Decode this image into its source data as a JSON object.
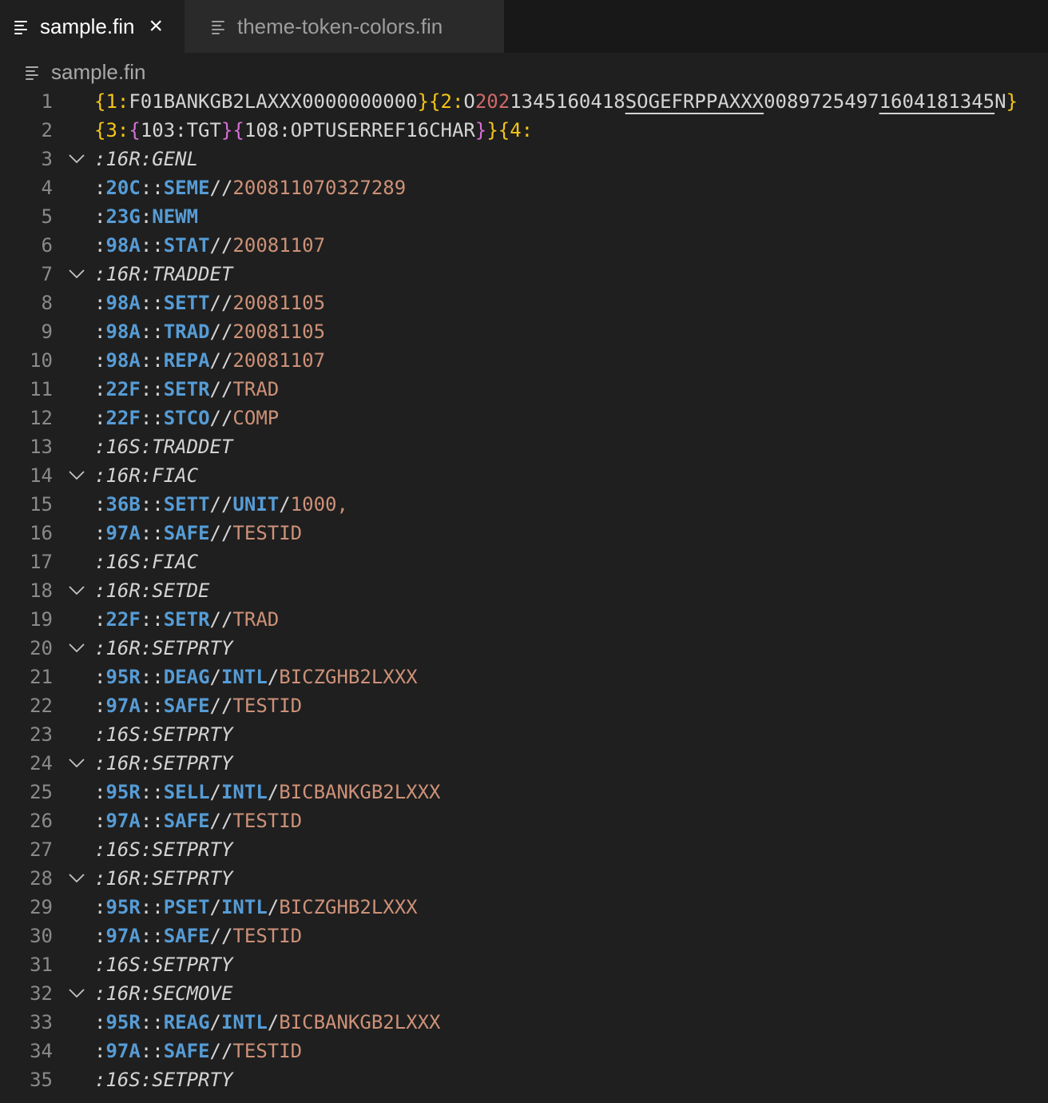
{
  "tabs": [
    {
      "label": "sample.fin",
      "active": true
    },
    {
      "label": "theme-token-colors.fin",
      "active": false
    }
  ],
  "breadcrumb": "sample.fin",
  "colors": {
    "background": "#1f1f1f",
    "tag": "#569cd6",
    "value": "#ce9178",
    "brace_outer": "#f5c518",
    "brace_inner": "#d670d6"
  },
  "lines": [
    {
      "n": "1",
      "fold": false,
      "tokens": [
        {
          "t": "{1:",
          "c": "t-brace-y"
        },
        {
          "t": "F01BANKGB2LAXXX0000000000",
          "c": "t-hdr"
        },
        {
          "t": "}",
          "c": "t-brace-y"
        },
        {
          "t": "{2:",
          "c": "t-brace-y"
        },
        {
          "t": "O",
          "c": "t-hdr"
        },
        {
          "t": "202",
          "c": "t-red"
        },
        {
          "t": "1345160418",
          "c": "t-hdr"
        },
        {
          "t": "SOGEFRPPAXXX",
          "c": "t-hdr t-uline"
        },
        {
          "t": "0089725497",
          "c": "t-hdr"
        },
        {
          "t": "1604181345",
          "c": "t-hdr t-uline"
        },
        {
          "t": "N",
          "c": "t-hdr"
        },
        {
          "t": "}",
          "c": "t-brace-y"
        }
      ]
    },
    {
      "n": "2",
      "fold": false,
      "tokens": [
        {
          "t": "{3:",
          "c": "t-brace-y"
        },
        {
          "t": "{",
          "c": "t-brace-p"
        },
        {
          "t": "103:TGT",
          "c": "t-hdr"
        },
        {
          "t": "}",
          "c": "t-brace-p"
        },
        {
          "t": "{",
          "c": "t-brace-p"
        },
        {
          "t": "108:OPTUSERREF16CHAR",
          "c": "t-hdr"
        },
        {
          "t": "}",
          "c": "t-brace-p"
        },
        {
          "t": "}",
          "c": "t-brace-y"
        },
        {
          "t": "{4:",
          "c": "t-brace-y"
        }
      ]
    },
    {
      "n": "3",
      "fold": true,
      "tokens": [
        {
          "t": ":16R:GENL",
          "c": "t-seq"
        }
      ]
    },
    {
      "n": "4",
      "fold": false,
      "tokens": [
        {
          "t": ":",
          "c": "t-punct"
        },
        {
          "t": "20C",
          "c": "t-tag"
        },
        {
          "t": "::",
          "c": "t-punct"
        },
        {
          "t": "SEME",
          "c": "t-qual"
        },
        {
          "t": "//",
          "c": "t-punct"
        },
        {
          "t": "200811070327289",
          "c": "t-val"
        }
      ]
    },
    {
      "n": "5",
      "fold": false,
      "tokens": [
        {
          "t": ":",
          "c": "t-punct"
        },
        {
          "t": "23G",
          "c": "t-tag"
        },
        {
          "t": ":",
          "c": "t-punct"
        },
        {
          "t": "NEWM",
          "c": "t-qual"
        }
      ]
    },
    {
      "n": "6",
      "fold": false,
      "tokens": [
        {
          "t": ":",
          "c": "t-punct"
        },
        {
          "t": "98A",
          "c": "t-tag"
        },
        {
          "t": "::",
          "c": "t-punct"
        },
        {
          "t": "STAT",
          "c": "t-qual"
        },
        {
          "t": "//",
          "c": "t-punct"
        },
        {
          "t": "20081107",
          "c": "t-val"
        }
      ]
    },
    {
      "n": "7",
      "fold": true,
      "tokens": [
        {
          "t": ":16R:TRADDET",
          "c": "t-seq"
        }
      ]
    },
    {
      "n": "8",
      "fold": false,
      "tokens": [
        {
          "t": ":",
          "c": "t-punct"
        },
        {
          "t": "98A",
          "c": "t-tag"
        },
        {
          "t": "::",
          "c": "t-punct"
        },
        {
          "t": "SETT",
          "c": "t-qual"
        },
        {
          "t": "//",
          "c": "t-punct"
        },
        {
          "t": "20081105",
          "c": "t-val"
        }
      ]
    },
    {
      "n": "9",
      "fold": false,
      "tokens": [
        {
          "t": ":",
          "c": "t-punct"
        },
        {
          "t": "98A",
          "c": "t-tag"
        },
        {
          "t": "::",
          "c": "t-punct"
        },
        {
          "t": "TRAD",
          "c": "t-qual"
        },
        {
          "t": "//",
          "c": "t-punct"
        },
        {
          "t": "20081105",
          "c": "t-val"
        }
      ]
    },
    {
      "n": "10",
      "fold": false,
      "tokens": [
        {
          "t": ":",
          "c": "t-punct"
        },
        {
          "t": "98A",
          "c": "t-tag"
        },
        {
          "t": "::",
          "c": "t-punct"
        },
        {
          "t": "REPA",
          "c": "t-qual"
        },
        {
          "t": "//",
          "c": "t-punct"
        },
        {
          "t": "20081107",
          "c": "t-val"
        }
      ]
    },
    {
      "n": "11",
      "fold": false,
      "tokens": [
        {
          "t": ":",
          "c": "t-punct"
        },
        {
          "t": "22F",
          "c": "t-tag"
        },
        {
          "t": "::",
          "c": "t-punct"
        },
        {
          "t": "SETR",
          "c": "t-qual"
        },
        {
          "t": "//",
          "c": "t-punct"
        },
        {
          "t": "TRAD",
          "c": "t-val"
        }
      ]
    },
    {
      "n": "12",
      "fold": false,
      "tokens": [
        {
          "t": ":",
          "c": "t-punct"
        },
        {
          "t": "22F",
          "c": "t-tag"
        },
        {
          "t": "::",
          "c": "t-punct"
        },
        {
          "t": "STCO",
          "c": "t-qual"
        },
        {
          "t": "//",
          "c": "t-punct"
        },
        {
          "t": "COMP",
          "c": "t-val"
        }
      ]
    },
    {
      "n": "13",
      "fold": false,
      "tokens": [
        {
          "t": ":16S:TRADDET",
          "c": "t-seq"
        }
      ]
    },
    {
      "n": "14",
      "fold": true,
      "tokens": [
        {
          "t": ":16R:FIAC",
          "c": "t-seq"
        }
      ]
    },
    {
      "n": "15",
      "fold": false,
      "tokens": [
        {
          "t": ":",
          "c": "t-punct"
        },
        {
          "t": "36B",
          "c": "t-tag"
        },
        {
          "t": "::",
          "c": "t-punct"
        },
        {
          "t": "SETT",
          "c": "t-qual"
        },
        {
          "t": "//",
          "c": "t-punct"
        },
        {
          "t": "UNIT",
          "c": "t-qual"
        },
        {
          "t": "/",
          "c": "t-punct"
        },
        {
          "t": "1000,",
          "c": "t-val"
        }
      ]
    },
    {
      "n": "16",
      "fold": false,
      "tokens": [
        {
          "t": ":",
          "c": "t-punct"
        },
        {
          "t": "97A",
          "c": "t-tag"
        },
        {
          "t": "::",
          "c": "t-punct"
        },
        {
          "t": "SAFE",
          "c": "t-qual"
        },
        {
          "t": "//",
          "c": "t-punct"
        },
        {
          "t": "TESTID",
          "c": "t-val"
        }
      ]
    },
    {
      "n": "17",
      "fold": false,
      "tokens": [
        {
          "t": ":16S:FIAC",
          "c": "t-seq"
        }
      ]
    },
    {
      "n": "18",
      "fold": true,
      "tokens": [
        {
          "t": ":16R:SETDE",
          "c": "t-seq"
        }
      ]
    },
    {
      "n": "19",
      "fold": false,
      "tokens": [
        {
          "t": ":",
          "c": "t-punct"
        },
        {
          "t": "22F",
          "c": "t-tag"
        },
        {
          "t": "::",
          "c": "t-punct"
        },
        {
          "t": "SETR",
          "c": "t-qual"
        },
        {
          "t": "//",
          "c": "t-punct"
        },
        {
          "t": "TRAD",
          "c": "t-val"
        }
      ]
    },
    {
      "n": "20",
      "fold": true,
      "tokens": [
        {
          "t": ":16R:SETPRTY",
          "c": "t-seq"
        }
      ]
    },
    {
      "n": "21",
      "fold": false,
      "tokens": [
        {
          "t": ":",
          "c": "t-punct"
        },
        {
          "t": "95R",
          "c": "t-tag"
        },
        {
          "t": "::",
          "c": "t-punct"
        },
        {
          "t": "DEAG",
          "c": "t-qual"
        },
        {
          "t": "/",
          "c": "t-punct"
        },
        {
          "t": "INTL",
          "c": "t-qual"
        },
        {
          "t": "/",
          "c": "t-punct"
        },
        {
          "t": "BICZGHB2LXXX",
          "c": "t-val"
        }
      ]
    },
    {
      "n": "22",
      "fold": false,
      "tokens": [
        {
          "t": ":",
          "c": "t-punct"
        },
        {
          "t": "97A",
          "c": "t-tag"
        },
        {
          "t": "::",
          "c": "t-punct"
        },
        {
          "t": "SAFE",
          "c": "t-qual"
        },
        {
          "t": "//",
          "c": "t-punct"
        },
        {
          "t": "TESTID",
          "c": "t-val"
        }
      ]
    },
    {
      "n": "23",
      "fold": false,
      "tokens": [
        {
          "t": ":16S:SETPRTY",
          "c": "t-seq"
        }
      ]
    },
    {
      "n": "24",
      "fold": true,
      "tokens": [
        {
          "t": ":16R:SETPRTY",
          "c": "t-seq"
        }
      ]
    },
    {
      "n": "25",
      "fold": false,
      "tokens": [
        {
          "t": ":",
          "c": "t-punct"
        },
        {
          "t": "95R",
          "c": "t-tag"
        },
        {
          "t": "::",
          "c": "t-punct"
        },
        {
          "t": "SELL",
          "c": "t-qual"
        },
        {
          "t": "/",
          "c": "t-punct"
        },
        {
          "t": "INTL",
          "c": "t-qual"
        },
        {
          "t": "/",
          "c": "t-punct"
        },
        {
          "t": "BICBANKGB2LXXX",
          "c": "t-val"
        }
      ]
    },
    {
      "n": "26",
      "fold": false,
      "tokens": [
        {
          "t": ":",
          "c": "t-punct"
        },
        {
          "t": "97A",
          "c": "t-tag"
        },
        {
          "t": "::",
          "c": "t-punct"
        },
        {
          "t": "SAFE",
          "c": "t-qual"
        },
        {
          "t": "//",
          "c": "t-punct"
        },
        {
          "t": "TESTID",
          "c": "t-val"
        }
      ]
    },
    {
      "n": "27",
      "fold": false,
      "tokens": [
        {
          "t": ":16S:SETPRTY",
          "c": "t-seq"
        }
      ]
    },
    {
      "n": "28",
      "fold": true,
      "tokens": [
        {
          "t": ":16R:SETPRTY",
          "c": "t-seq"
        }
      ]
    },
    {
      "n": "29",
      "fold": false,
      "tokens": [
        {
          "t": ":",
          "c": "t-punct"
        },
        {
          "t": "95R",
          "c": "t-tag"
        },
        {
          "t": "::",
          "c": "t-punct"
        },
        {
          "t": "PSET",
          "c": "t-qual"
        },
        {
          "t": "/",
          "c": "t-punct"
        },
        {
          "t": "INTL",
          "c": "t-qual"
        },
        {
          "t": "/",
          "c": "t-punct"
        },
        {
          "t": "BICZGHB2LXXX",
          "c": "t-val"
        }
      ]
    },
    {
      "n": "30",
      "fold": false,
      "tokens": [
        {
          "t": ":",
          "c": "t-punct"
        },
        {
          "t": "97A",
          "c": "t-tag"
        },
        {
          "t": "::",
          "c": "t-punct"
        },
        {
          "t": "SAFE",
          "c": "t-qual"
        },
        {
          "t": "//",
          "c": "t-punct"
        },
        {
          "t": "TESTID",
          "c": "t-val"
        }
      ]
    },
    {
      "n": "31",
      "fold": false,
      "tokens": [
        {
          "t": ":16S:SETPRTY",
          "c": "t-seq"
        }
      ]
    },
    {
      "n": "32",
      "fold": true,
      "tokens": [
        {
          "t": ":16R:SECMOVE",
          "c": "t-seq"
        }
      ]
    },
    {
      "n": "33",
      "fold": false,
      "tokens": [
        {
          "t": ":",
          "c": "t-punct"
        },
        {
          "t": "95R",
          "c": "t-tag"
        },
        {
          "t": "::",
          "c": "t-punct"
        },
        {
          "t": "REAG",
          "c": "t-qual"
        },
        {
          "t": "/",
          "c": "t-punct"
        },
        {
          "t": "INTL",
          "c": "t-qual"
        },
        {
          "t": "/",
          "c": "t-punct"
        },
        {
          "t": "BICBANKGB2LXXX",
          "c": "t-val"
        }
      ]
    },
    {
      "n": "34",
      "fold": false,
      "tokens": [
        {
          "t": ":",
          "c": "t-punct"
        },
        {
          "t": "97A",
          "c": "t-tag"
        },
        {
          "t": "::",
          "c": "t-punct"
        },
        {
          "t": "SAFE",
          "c": "t-qual"
        },
        {
          "t": "//",
          "c": "t-punct"
        },
        {
          "t": "TESTID",
          "c": "t-val"
        }
      ]
    },
    {
      "n": "35",
      "fold": false,
      "tokens": [
        {
          "t": ":16S:SETPRTY",
          "c": "t-seq"
        }
      ]
    }
  ]
}
